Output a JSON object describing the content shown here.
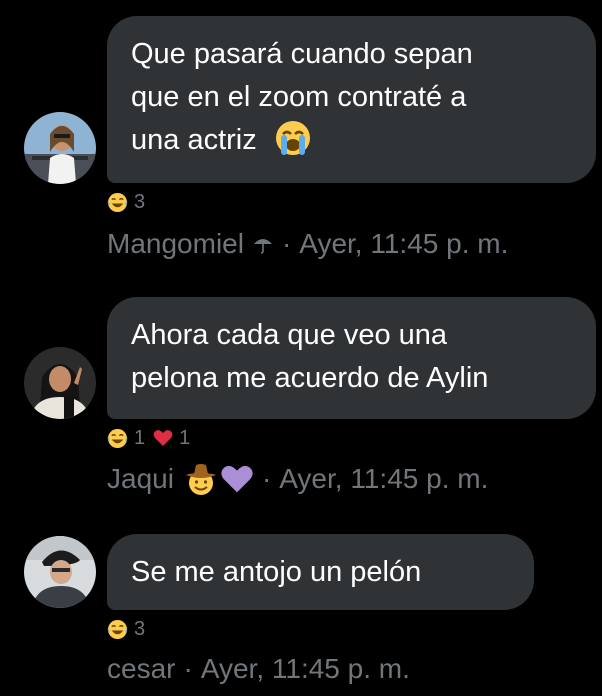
{
  "messages": [
    {
      "lines": [
        "Que pasará cuando sepan",
        "que en el zoom contraté a",
        "una actriz"
      ],
      "trailing_emoji": "loudly-crying-face",
      "reactions": [
        {
          "emoji": "face-with-tears-of-joy",
          "count": "3"
        }
      ],
      "author": "Mangomiel",
      "author_emoji": "umbrella",
      "separator": "·",
      "timestamp": "Ayer, 11:45 p. m."
    },
    {
      "lines": [
        "Ahora cada que veo una",
        "pelona me acuerdo de Aylin"
      ],
      "reactions": [
        {
          "emoji": "face-with-tears-of-joy",
          "count": "1"
        },
        {
          "emoji": "red-heart",
          "count": "1"
        }
      ],
      "author": "Jaqui",
      "author_emojis": [
        "cowboy-hat-face",
        "purple-heart"
      ],
      "separator": "·",
      "timestamp": "Ayer, 11:45 p. m."
    },
    {
      "lines": [
        "Se me antojo un pelón"
      ],
      "reactions": [
        {
          "emoji": "face-with-tears-of-joy",
          "count": "3"
        }
      ],
      "author": "cesar",
      "separator": "·",
      "timestamp": "Ayer, 11:45 p. m."
    }
  ],
  "colors": {
    "background": "#000000",
    "bubble": "#2f3336",
    "text": "#ffffff",
    "muted": "#71767b",
    "heart": "#f91880"
  }
}
